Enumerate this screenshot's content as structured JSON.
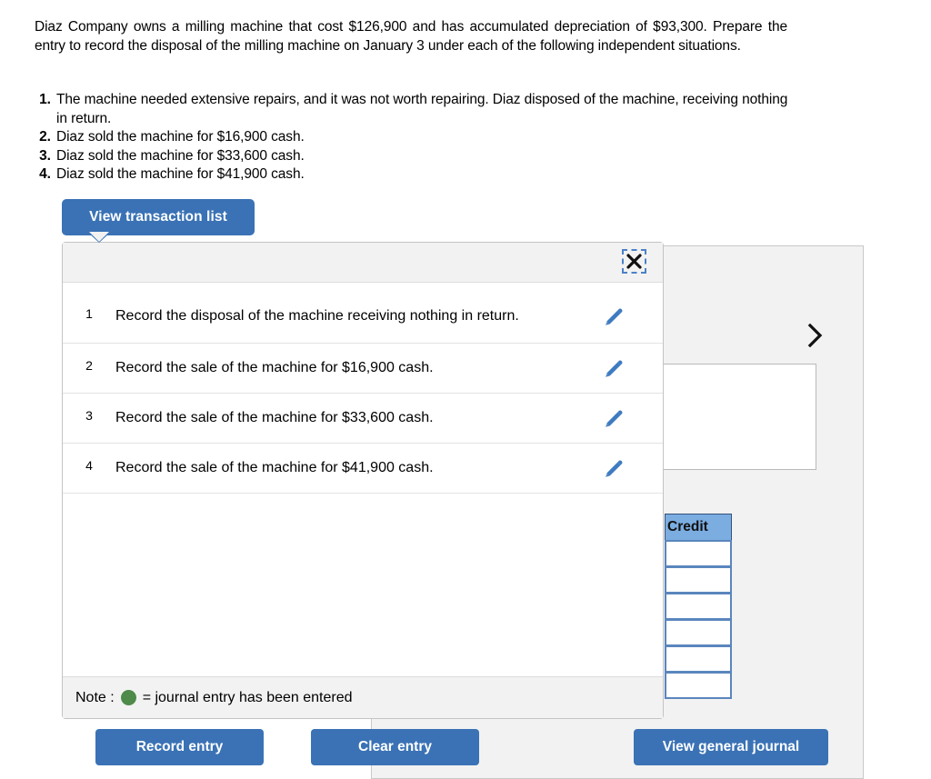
{
  "problem": {
    "paragraph": "Diaz Company owns a milling machine that cost $126,900 and has accumulated depreciation of $93,300. Prepare the entry to record the disposal of the milling machine on January 3 under each of the following independent situations.",
    "situations": [
      {
        "num": "1.",
        "text": "The machine needed extensive repairs, and it was not worth repairing. Diaz disposed of the machine, receiving nothing in return."
      },
      {
        "num": "2.",
        "text": "Diaz sold the machine for $16,900 cash."
      },
      {
        "num": "3.",
        "text": "Diaz sold the machine for $33,600 cash."
      },
      {
        "num": "4.",
        "text": "Diaz sold the machine for $41,900 cash."
      }
    ]
  },
  "tab": {
    "view_transaction_list_label": "View transaction list"
  },
  "modal": {
    "close_icon": "close-icon",
    "transactions": [
      {
        "num": "1",
        "description": "Record the disposal of the machine receiving nothing in return.",
        "edit_icon": "pencil-icon"
      },
      {
        "num": "2",
        "description": "Record the sale of the machine for $16,900 cash.",
        "edit_icon": "pencil-icon"
      },
      {
        "num": "3",
        "description": "Record the sale of the machine for $33,600 cash.",
        "edit_icon": "pencil-icon"
      },
      {
        "num": "4",
        "description": "Record the sale of the machine for $41,900 cash.",
        "edit_icon": "pencil-icon"
      }
    ],
    "note": {
      "prefix": "Note :",
      "suffix": "= journal entry has been entered",
      "dot_color": "#4e8a4a"
    }
  },
  "journal_panel": {
    "credit_header": "Credit",
    "credit_cells": [
      "",
      "",
      "",
      "",
      "",
      ""
    ],
    "next_icon": "chevron-right-icon"
  },
  "footer": {
    "record_entry_label": "Record entry",
    "clear_entry_label": "Clear entry",
    "view_general_journal_label": "View general journal"
  },
  "colors": {
    "primary_blue": "#3a72b5",
    "header_blue": "#7bade0",
    "panel_grey": "#f2f2f2",
    "green_dot": "#4e8a4a"
  }
}
